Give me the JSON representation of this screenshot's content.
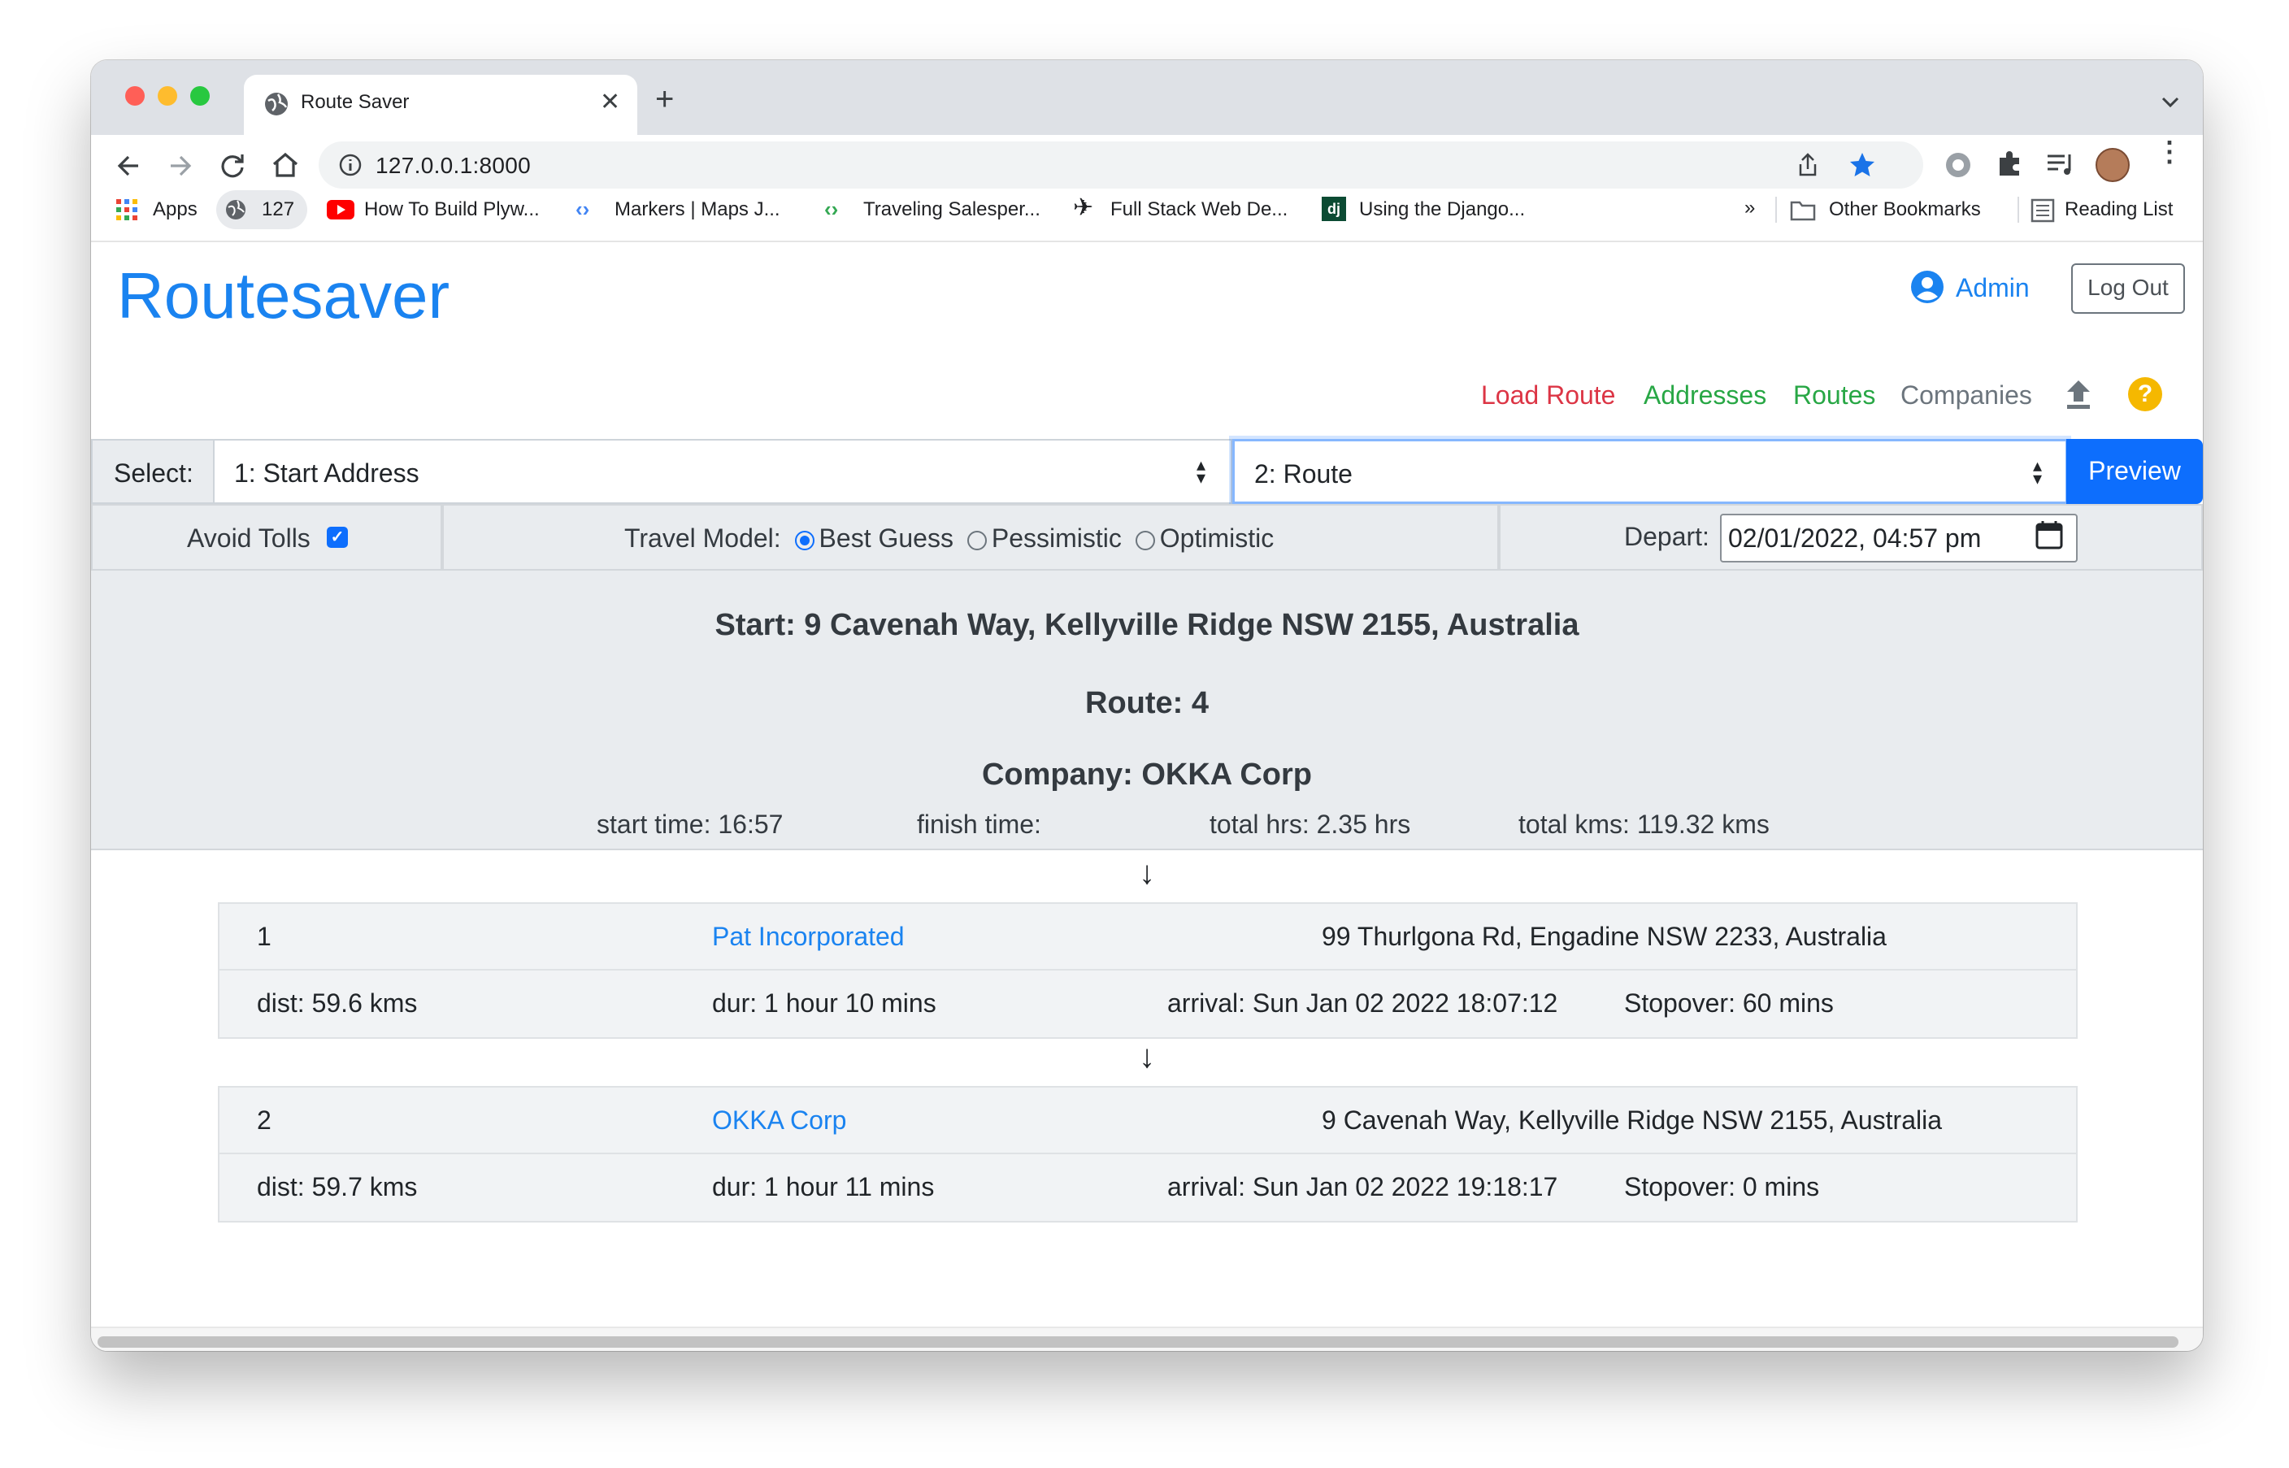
{
  "browser": {
    "tab_title": "Route Saver",
    "url": "127.0.0.1:8000",
    "bookmarks": [
      {
        "label": "Apps",
        "icon": "apps-grid-icon"
      },
      {
        "label": "127",
        "icon": "globe-icon"
      },
      {
        "label": "How To Build Plyw...",
        "icon": "youtube-icon"
      },
      {
        "label": "Markers  |  Maps J...",
        "icon": "google-dev-icon"
      },
      {
        "label": "Traveling Salesper...",
        "icon": "google-dev-icon"
      },
      {
        "label": "Full Stack Web De...",
        "icon": "bird-icon"
      },
      {
        "label": "Using the Django...",
        "icon": "django-icon"
      }
    ],
    "more_bookmarks": "»",
    "other_bookmarks": "Other Bookmarks",
    "reading_list": "Reading List"
  },
  "header": {
    "brand": "Routesaver",
    "user": "Admin",
    "logout": "Log Out"
  },
  "nav": {
    "load_route": "Load Route",
    "addresses": "Addresses",
    "routes": "Routes",
    "companies": "Companies",
    "help": "?"
  },
  "selectors": {
    "label": "Select:",
    "start_address": "1: Start Address",
    "route": "2: Route",
    "preview": "Preview"
  },
  "options": {
    "avoid_tolls": "Avoid Tolls",
    "avoid_tolls_checked": true,
    "travel_model_label": "Travel Model:",
    "models": [
      "Best Guess",
      "Pessimistic",
      "Optimistic"
    ],
    "selected_model": "Best Guess",
    "depart_label": "Depart:",
    "depart_value": "02/01/2022, 04:57 pm"
  },
  "summary": {
    "start": "Start: 9 Cavenah Way, Kellyville Ridge NSW 2155, Australia",
    "route": "Route: 4",
    "company": "Company: OKKA Corp",
    "start_time": "start time: 16:57",
    "finish_time": "finish time:",
    "total_hrs": "total hrs: 2.35 hrs",
    "total_kms": "total kms: 119.32 kms"
  },
  "arrow": "↓",
  "stops": [
    {
      "number": "1",
      "company": "Pat Incorporated",
      "address": "99 Thurlgona Rd, Engadine NSW 2233, Australia",
      "dist": "dist: 59.6 kms",
      "dur": "dur: 1 hour 10 mins",
      "arrival": "arrival: Sun Jan 02 2022 18:07:12",
      "stopover": "Stopover: 60 mins"
    },
    {
      "number": "2",
      "company": "OKKA Corp",
      "address": "9 Cavenah Way, Kellyville Ridge NSW 2155, Australia",
      "dist": "dist: 59.7 kms",
      "dur": "dur: 1 hour 11 mins",
      "arrival": "arrival: Sun Jan 02 2022 19:18:17",
      "stopover": "Stopover: 0 mins"
    }
  ],
  "colors": {
    "brand": "#1a83f0",
    "load_route": "#dc3545",
    "addresses": "#28a745",
    "routes": "#28a745",
    "companies": "#6c757d",
    "help": "#f5b800",
    "primary": "#0d6efd"
  }
}
